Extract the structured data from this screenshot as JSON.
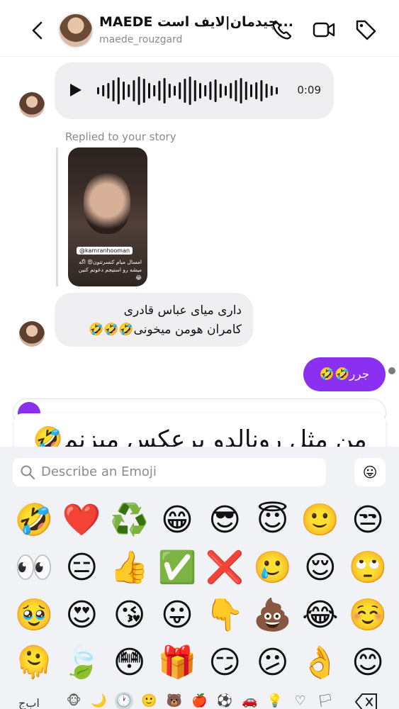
{
  "header": {
    "title": "MAEDE چیدمان|لایف است...",
    "handle": "maede_rouzgard"
  },
  "chat": {
    "voice_message": {
      "duration": "0:09"
    },
    "reply_note": "Replied to your story",
    "story": {
      "tag": "@kamranhooman",
      "caption": "امسال میام کنسرتتون😍 اگه میشه رو استیجم دعوتم کنین😂"
    },
    "incoming_text": {
      "line1": "داری میای عباس قادری",
      "line2": "کامران هومن میخونی🤣🤣🤣"
    },
    "outgoing_text": "جرر🤣🤣"
  },
  "caption_overlay": "من مثل رونالدو برعکس میزنم🤣",
  "keyboard": {
    "search_placeholder": "Describe an Emoji",
    "emojis": [
      "🤣",
      "❤️",
      "♻️",
      "😁",
      "😎",
      "😇",
      "🙂",
      "😒",
      "👀",
      "😑",
      "👍",
      "✅",
      "❌",
      "🥲",
      "😌",
      "🙄",
      "🥹",
      "😍",
      "😘",
      "😛",
      "👇",
      "💩",
      "😂",
      "☺️",
      "🫠",
      "🍃",
      "😳",
      "🎁",
      "😏",
      "😕",
      "👌",
      "😊"
    ],
    "language_key": "اب‌ج",
    "category_icons": [
      "🐵",
      "🌙",
      "🕐",
      "🙂",
      "🐻",
      "🍎",
      "⚽",
      "🚗",
      "💡",
      "♡",
      "🏳"
    ]
  },
  "colors": {
    "accent": "#8b2ff0",
    "bubble_in": "#efeff2",
    "keyboard_bg": "#f1f2f6"
  }
}
